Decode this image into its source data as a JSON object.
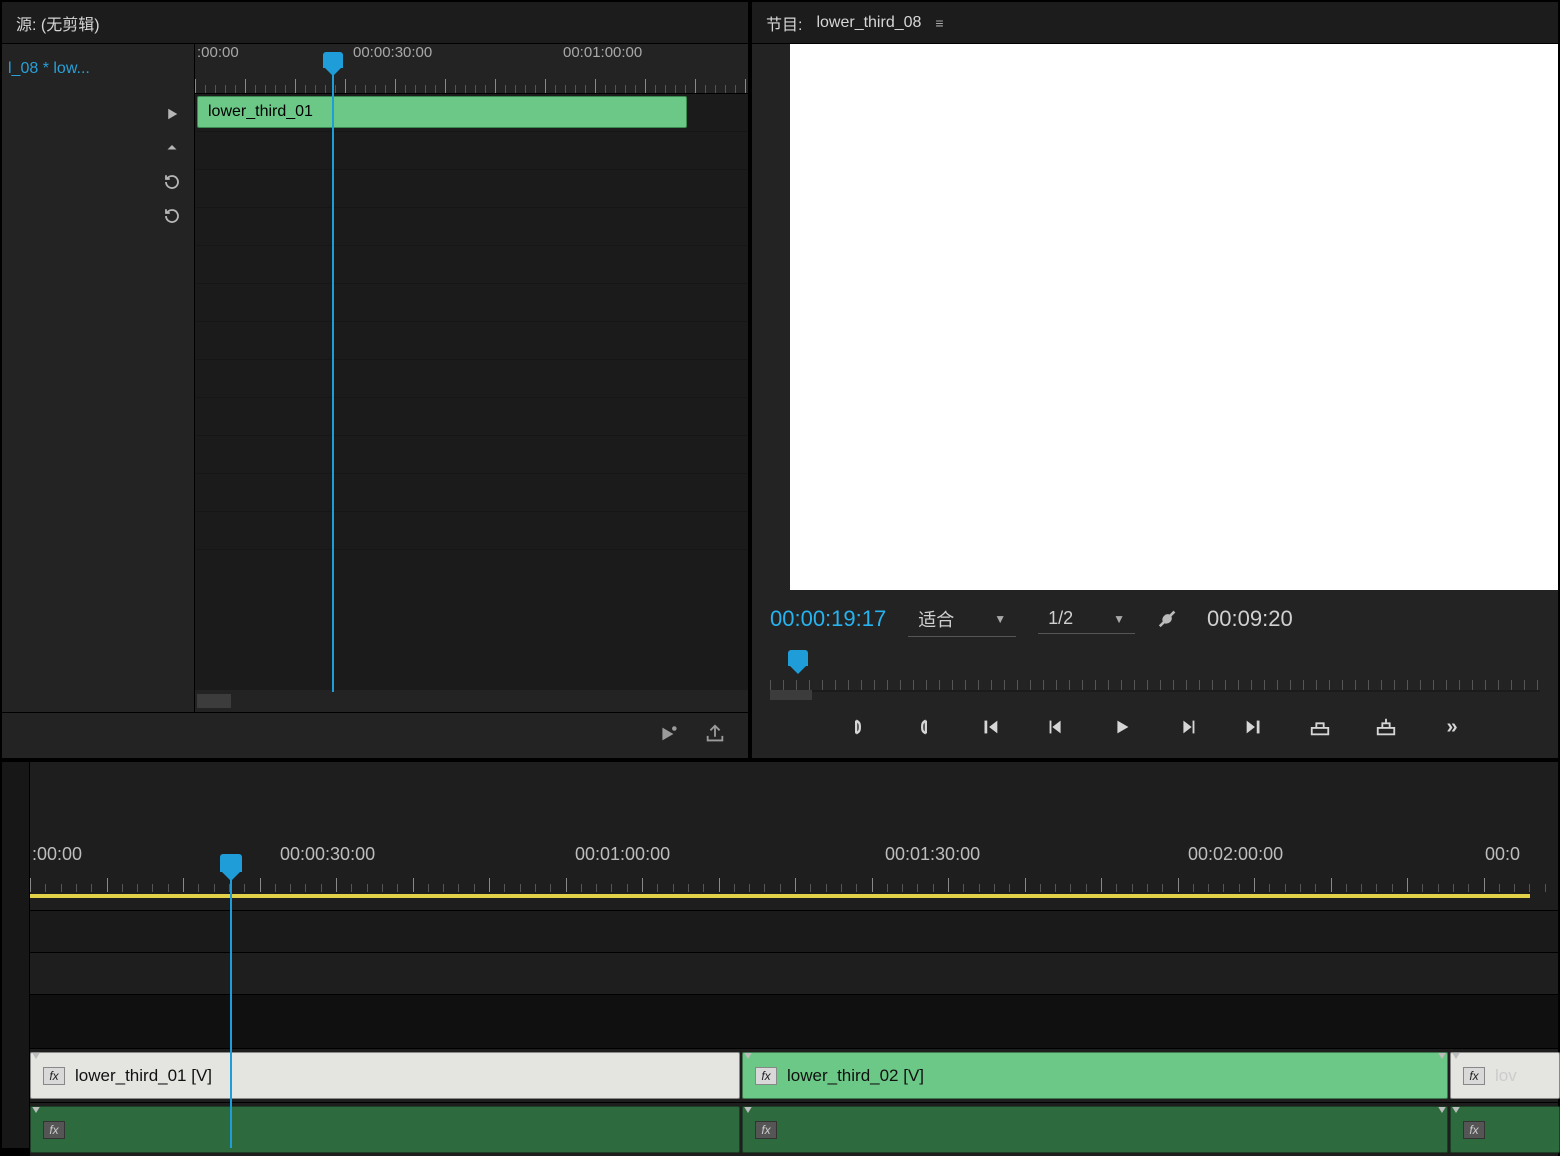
{
  "source_panel": {
    "title": "源: (无剪辑)",
    "tab_label": "l_08 * low...",
    "ruler_labels": [
      ":00:00",
      "00:00:30:00",
      "00:01:00:00"
    ],
    "clip_name": "lower_third_01"
  },
  "program_panel": {
    "header_prefix": "节目:",
    "header_name": "lower_third_08",
    "timecode_current": "00:00:19:17",
    "fit_label": "适合",
    "resolution_label": "1/2",
    "timecode_total": "00:09:20"
  },
  "timeline": {
    "ruler_labels": [
      ":00:00",
      "00:00:30:00",
      "00:01:00:00",
      "00:01:30:00",
      "00:02:00:00",
      "00:0"
    ],
    "clips_v1": [
      {
        "name": "lower_third_01 [V]",
        "style": "light"
      },
      {
        "name": "lower_third_02 [V]",
        "style": "green"
      },
      {
        "name": "lov",
        "style": "tiny"
      }
    ]
  },
  "colors": {
    "accent_blue": "#1f9dd8",
    "clip_green": "#6cc886",
    "clip_dark_green": "#2d6b3f",
    "work_area_yellow": "#e2d24a"
  }
}
